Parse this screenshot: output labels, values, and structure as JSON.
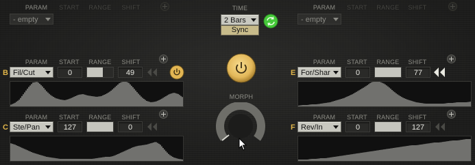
{
  "labels": {
    "param": "PARAM",
    "start": "START",
    "range": "RANGE",
    "shift": "SHIFT",
    "time": "TIME",
    "morph": "MORPH"
  },
  "time": {
    "value": "2 Bars",
    "sync_label": "Sync"
  },
  "top_slots": [
    {
      "param": "- empty"
    },
    {
      "param": "- empty"
    }
  ],
  "lanes": [
    {
      "id": "B",
      "param": "Fil/Cut",
      "start": "0",
      "range": 0.6,
      "shift": "49",
      "wave": [
        2,
        5,
        10,
        19,
        28,
        35,
        36,
        30,
        22,
        16,
        12,
        10,
        9,
        11,
        14,
        17,
        18,
        16,
        15,
        14,
        15,
        18,
        22,
        28,
        34,
        37,
        35,
        28,
        20,
        13,
        8,
        6,
        7,
        10,
        14,
        18,
        20,
        18,
        13
      ]
    },
    {
      "id": "C",
      "param": "Ste/Pan",
      "start": "127",
      "range": 1.0,
      "shift": "0",
      "wave": [
        26,
        24,
        21,
        18,
        15,
        12,
        10,
        8,
        6,
        5,
        4,
        3,
        3,
        3,
        3,
        3,
        3,
        3,
        3,
        4,
        5,
        6,
        6,
        8,
        11,
        14,
        17,
        20,
        22,
        23,
        24,
        26,
        28,
        24,
        16,
        9,
        5,
        3,
        2
      ]
    },
    {
      "id": "E",
      "param": "For/Shar",
      "start": "0",
      "range": 1.0,
      "shift": "77",
      "wave": [
        1,
        2,
        2,
        3,
        3,
        4,
        5,
        6,
        8,
        10,
        12,
        15,
        18,
        22,
        26,
        30,
        35,
        37,
        36,
        33,
        28,
        22,
        17,
        13,
        10,
        8,
        6,
        5,
        4,
        4,
        4,
        4,
        4,
        5,
        5,
        6,
        6,
        6,
        7
      ]
    },
    {
      "id": "F",
      "param": "Rev/In",
      "start": "0",
      "range": 1.0,
      "shift": "127",
      "wave": [
        2,
        2,
        2,
        3,
        3,
        4,
        4,
        5,
        6,
        7,
        8,
        9,
        10,
        11,
        12,
        13,
        14,
        15,
        16,
        17,
        18,
        19,
        20,
        21,
        22,
        23,
        23,
        24,
        25,
        26,
        27,
        27,
        28,
        29,
        30,
        30,
        31,
        32,
        32
      ]
    }
  ],
  "colors": {
    "accent_gold": "#e0b54a",
    "power_button": "#e9c46a",
    "sync_green": "#46c93a"
  }
}
